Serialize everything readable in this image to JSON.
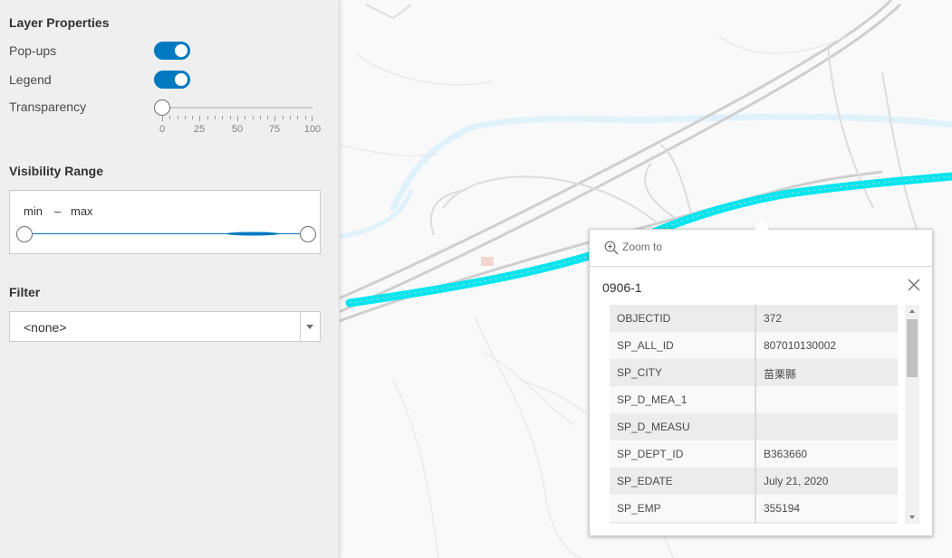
{
  "panel": {
    "layer_properties_title": "Layer Properties",
    "popups_label": "Pop-ups",
    "popups_on": true,
    "legend_label": "Legend",
    "legend_on": true,
    "transparency_label": "Transparency",
    "transparency_value": 0,
    "transparency_ticks": [
      "0",
      "25",
      "50",
      "75",
      "100"
    ],
    "visibility_title": "Visibility Range",
    "visibility_min_label": "min",
    "visibility_dash": "–",
    "visibility_max_label": "max",
    "filter_title": "Filter",
    "filter_value": "<none>"
  },
  "popup": {
    "zoom_label": "Zoom to",
    "title": "0906-1",
    "fields": [
      {
        "key": "OBJECTID",
        "value": "372"
      },
      {
        "key": "SP_ALL_ID",
        "value": "807010130002"
      },
      {
        "key": "SP_CITY",
        "value": "苗栗縣"
      },
      {
        "key": "SP_D_MEA_1",
        "value": ""
      },
      {
        "key": "SP_D_MEASU",
        "value": ""
      },
      {
        "key": "SP_DEPT_ID",
        "value": "B363660"
      },
      {
        "key": "SP_EDATE",
        "value": "July 21, 2020"
      },
      {
        "key": "SP_EMP",
        "value": "355194"
      },
      {
        "key": "",
        "value": ""
      }
    ]
  },
  "colors": {
    "accent": "#0079c1",
    "highlight_road": "#00e5ee",
    "river": "#dff2fb"
  }
}
